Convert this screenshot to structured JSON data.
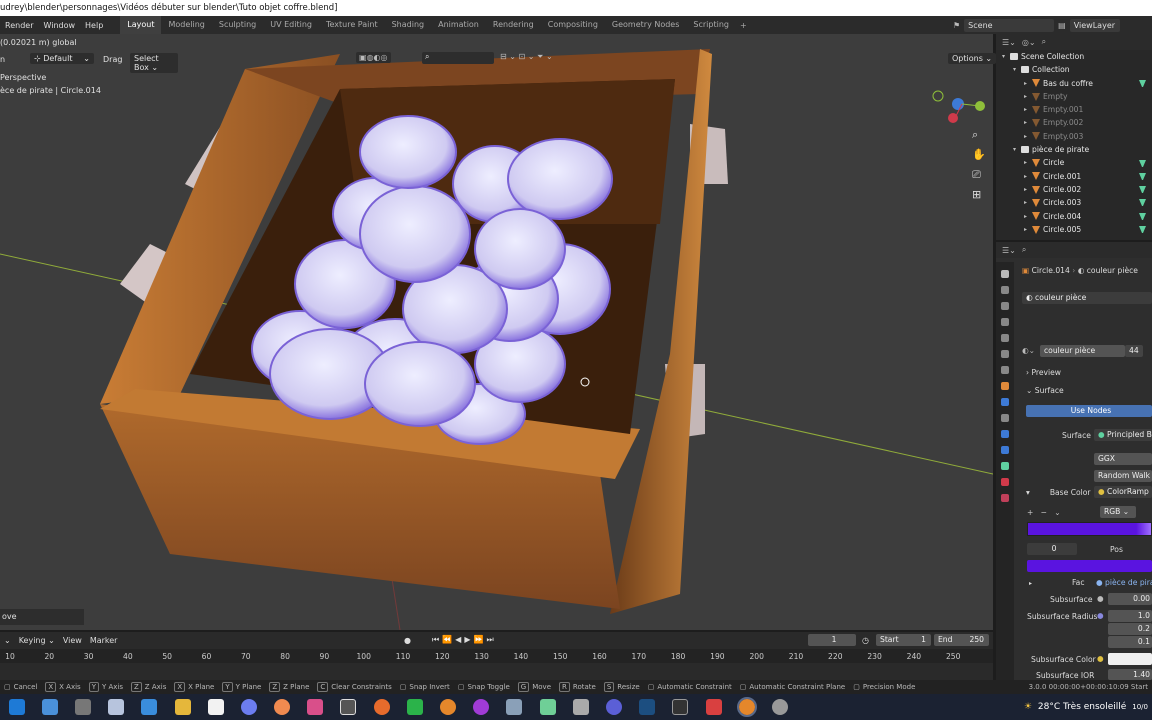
{
  "window": {
    "title": "udrey\\blender\\personnages\\Vidéos débuter sur blender\\Tuto objet coffre.blend]"
  },
  "topbar": {
    "menus": [
      "Render",
      "Window",
      "Help"
    ],
    "workspaces": [
      "Layout",
      "Modeling",
      "Sculpting",
      "UV Editing",
      "Texture Paint",
      "Shading",
      "Animation",
      "Rendering",
      "Compositing",
      "Geometry Nodes",
      "Scripting"
    ],
    "active_workspace": "Layout",
    "add_tab": "+",
    "scene": "Scene",
    "view_layer": "ViewLayer"
  },
  "viewport": {
    "header_info": "(0.02021 m) global",
    "orientation_prefix": "n",
    "orientation": "Default",
    "drag_label": "Drag",
    "select_mode": "Select Box",
    "options": "Options",
    "view_name": "Perspective",
    "object_info": "èce de pirate | Circle.014",
    "last_op": "ove",
    "colors": {
      "background": "#3d3d3d",
      "coin": "#c8c4ee",
      "coin_edge": "#7a62d6",
      "wood": "#8a5225",
      "wood_light": "#d4883a",
      "x_axis": "#9fbf3a"
    }
  },
  "outliner": {
    "items": [
      {
        "label": "Scene Collection",
        "depth": 0,
        "kind": "scene",
        "dim": false
      },
      {
        "label": "Collection",
        "depth": 1,
        "kind": "collection",
        "dim": false
      },
      {
        "label": "Bas du coffre",
        "depth": 2,
        "kind": "object",
        "dim": false
      },
      {
        "label": "Empty",
        "depth": 2,
        "kind": "empty",
        "dim": true
      },
      {
        "label": "Empty.001",
        "depth": 2,
        "kind": "empty",
        "dim": true
      },
      {
        "label": "Empty.002",
        "depth": 2,
        "kind": "empty",
        "dim": true
      },
      {
        "label": "Empty.003",
        "depth": 2,
        "kind": "empty",
        "dim": true
      },
      {
        "label": "pièce de pirate",
        "depth": 1,
        "kind": "collection",
        "dim": false
      },
      {
        "label": "Circle",
        "depth": 2,
        "kind": "object",
        "dim": false
      },
      {
        "label": "Circle.001",
        "depth": 2,
        "kind": "object",
        "dim": false
      },
      {
        "label": "Circle.002",
        "depth": 2,
        "kind": "object",
        "dim": false
      },
      {
        "label": "Circle.003",
        "depth": 2,
        "kind": "object",
        "dim": false
      },
      {
        "label": "Circle.004",
        "depth": 2,
        "kind": "object",
        "dim": false
      },
      {
        "label": "Circle.005",
        "depth": 2,
        "kind": "object",
        "dim": false
      }
    ]
  },
  "properties": {
    "breadcrumb_object": "Circle.014",
    "breadcrumb_material": "couleur pièce",
    "material_slot": "couleur pièce",
    "material_name": "couleur pièce",
    "users": "44",
    "preview": "Preview",
    "surface_panel": "Surface",
    "use_nodes": "Use Nodes",
    "surface_label": "Surface",
    "surface_value": "Principled BS",
    "distribution": "GGX",
    "subsurface_method": "Random Walk",
    "base_color_label": "Base Color",
    "base_color_value": "ColorRamp",
    "ramp_mode": "RGB",
    "ramp_index": "0",
    "pos_label": "Pos",
    "fac_label": "Fac",
    "fac_value": "pièce de pira",
    "subsurface_label": "Subsurface",
    "subsurface_value": "0.00",
    "subsurface_radius_label": "Subsurface Radius",
    "subsurface_radius_values": [
      "1.0",
      "0.2",
      "0.1"
    ],
    "subsurface_color_label": "Subsurface Color",
    "subsurface_ior_label": "Subsurface IOR",
    "subsurface_ior_value": "1.40",
    "ramp_color": "#5a14e0",
    "ramp_end": "#a070ff"
  },
  "timeline": {
    "keying": "Keying",
    "view": "View",
    "marker": "Marker",
    "current_frame": "1",
    "start_label": "Start",
    "start": "1",
    "end_label": "End",
    "end": "250",
    "ruler": [
      "10",
      "20",
      "30",
      "40",
      "50",
      "60",
      "70",
      "80",
      "90",
      "100",
      "110",
      "120",
      "130",
      "140",
      "150",
      "160",
      "170",
      "180",
      "190",
      "200",
      "210",
      "220",
      "230",
      "240",
      "250"
    ]
  },
  "status": {
    "items": [
      {
        "key": "",
        "label": "Cancel"
      },
      {
        "key": "X",
        "label": "X Axis"
      },
      {
        "key": "Y",
        "label": "Y Axis"
      },
      {
        "key": "Z",
        "label": "Z Axis"
      },
      {
        "key": "X",
        "label": "X Plane"
      },
      {
        "key": "Y",
        "label": "Y Plane"
      },
      {
        "key": "Z",
        "label": "Z Plane"
      },
      {
        "key": "C",
        "label": "Clear Constraints"
      },
      {
        "key": "",
        "label": "Snap Invert"
      },
      {
        "key": "",
        "label": "Snap Toggle"
      },
      {
        "key": "G",
        "label": "Move"
      },
      {
        "key": "R",
        "label": "Rotate"
      },
      {
        "key": "S",
        "label": "Resize"
      },
      {
        "key": "",
        "label": "Automatic Constraint"
      },
      {
        "key": "",
        "label": "Automatic Constraint Plane"
      },
      {
        "key": "",
        "label": "Precision Mode"
      }
    ],
    "version": "3.0.0 00:00:00+00:00:10:09 Start"
  },
  "taskbar": {
    "weather": "28°C  Très ensoleillé",
    "time_partial": "10/0"
  }
}
